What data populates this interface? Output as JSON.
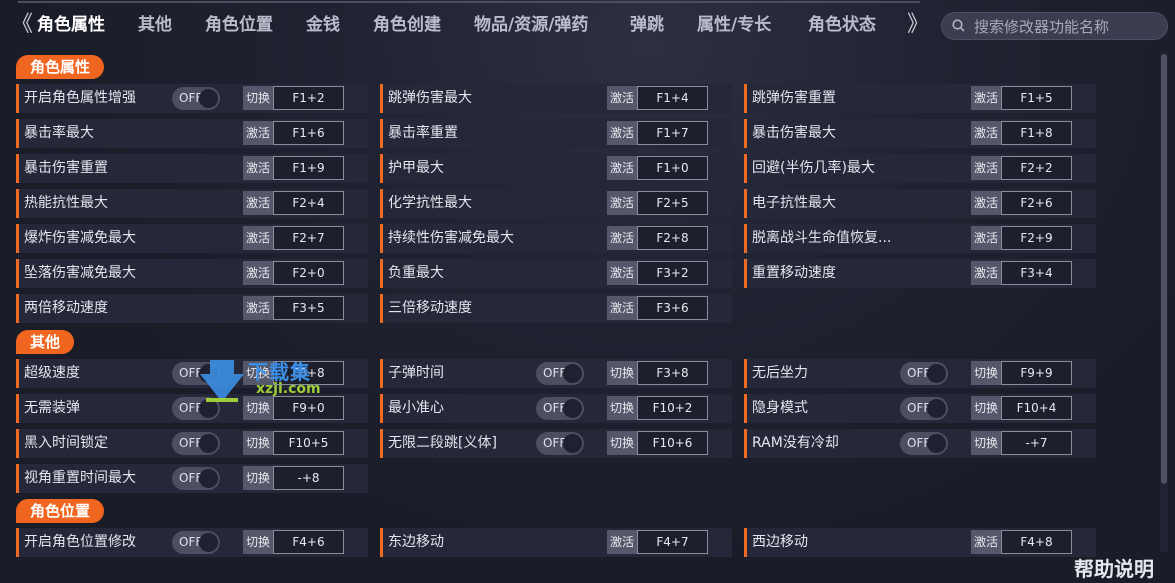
{
  "tabs": [
    "角色属性",
    "其他",
    "角色位置",
    "金钱",
    "角色创建",
    "物品/资源/弹药",
    "弹跳",
    "属性/专长",
    "角色状态"
  ],
  "search": {
    "placeholder": "搜索修改器功能名称"
  },
  "nav": {
    "left_arrow": "《",
    "right_arrow": "》"
  },
  "sections": [
    {
      "title": "角色属性",
      "rows": [
        [
          {
            "label": "开启角色属性增强",
            "toggle": "OFF",
            "mode": "切换",
            "key": "F1+2"
          },
          {
            "label": "跳弹伤害最大",
            "mode": "激活",
            "key": "F1+4"
          },
          {
            "label": "跳弹伤害重置",
            "mode": "激活",
            "key": "F1+5"
          }
        ],
        [
          {
            "label": "暴击率最大",
            "mode": "激活",
            "key": "F1+6"
          },
          {
            "label": "暴击率重置",
            "mode": "激活",
            "key": "F1+7"
          },
          {
            "label": "暴击伤害最大",
            "mode": "激活",
            "key": "F1+8"
          }
        ],
        [
          {
            "label": "暴击伤害重置",
            "mode": "激活",
            "key": "F1+9"
          },
          {
            "label": "护甲最大",
            "mode": "激活",
            "key": "F1+0"
          },
          {
            "label": "回避(半伤几率)最大",
            "mode": "激活",
            "key": "F2+2"
          }
        ],
        [
          {
            "label": "热能抗性最大",
            "mode": "激活",
            "key": "F2+4"
          },
          {
            "label": "化学抗性最大",
            "mode": "激活",
            "key": "F2+5"
          },
          {
            "label": "电子抗性最大",
            "mode": "激活",
            "key": "F2+6"
          }
        ],
        [
          {
            "label": "爆炸伤害减免最大",
            "mode": "激活",
            "key": "F2+7"
          },
          {
            "label": "持续性伤害减免最大",
            "mode": "激活",
            "key": "F2+8"
          },
          {
            "label": "脱离战斗生命值恢复...",
            "mode": "激活",
            "key": "F2+9"
          }
        ],
        [
          {
            "label": "坠落伤害减免最大",
            "mode": "激活",
            "key": "F2+0"
          },
          {
            "label": "负重最大",
            "mode": "激活",
            "key": "F3+2"
          },
          {
            "label": "重置移动速度",
            "mode": "激活",
            "key": "F3+4"
          }
        ],
        [
          {
            "label": "两倍移动速度",
            "mode": "激活",
            "key": "F3+5"
          },
          {
            "label": "三倍移动速度",
            "mode": "激活",
            "key": "F3+6"
          }
        ]
      ]
    },
    {
      "title": "其他",
      "rows": [
        [
          {
            "label": "超级速度",
            "toggle": "OFF",
            "mode": "切换",
            "key": "F8+8"
          },
          {
            "label": "子弹时间",
            "toggle": "OFF",
            "mode": "切换",
            "key": "F3+8"
          },
          {
            "label": "无后坐力",
            "toggle": "OFF",
            "mode": "切换",
            "key": "F9+9"
          }
        ],
        [
          {
            "label": "无需装弹",
            "toggle": "OFF",
            "mode": "切换",
            "key": "F9+0"
          },
          {
            "label": "最小准心",
            "toggle": "OFF",
            "mode": "切换",
            "key": "F10+2"
          },
          {
            "label": "隐身模式",
            "toggle": "OFF",
            "mode": "切换",
            "key": "F10+4"
          }
        ],
        [
          {
            "label": "黑入时间锁定",
            "toggle": "OFF",
            "mode": "切换",
            "key": "F10+5"
          },
          {
            "label": "无限二段跳[义体]",
            "toggle": "OFF",
            "mode": "切换",
            "key": "F10+6"
          },
          {
            "label": "RAM没有冷却",
            "toggle": "OFF",
            "mode": "切换",
            "key": "-+7"
          }
        ],
        [
          {
            "label": "视角重置时间最大",
            "toggle": "OFF",
            "mode": "切换",
            "key": "-+8"
          }
        ]
      ]
    },
    {
      "title": "角色位置",
      "rows": [
        [
          {
            "label": "开启角色位置修改",
            "toggle": "OFF",
            "mode": "切换",
            "key": "F4+6"
          },
          {
            "label": "东边移动",
            "mode": "激活",
            "key": "F4+7"
          },
          {
            "label": "西边移动",
            "mode": "激活",
            "key": "F4+8"
          }
        ]
      ]
    }
  ],
  "help": "帮助说明",
  "watermark": {
    "text": "下载集",
    "sub": "xzji.com"
  },
  "colors": {
    "accent": "#f0651f",
    "background": "#1b1e2b",
    "cell": "#252838"
  }
}
